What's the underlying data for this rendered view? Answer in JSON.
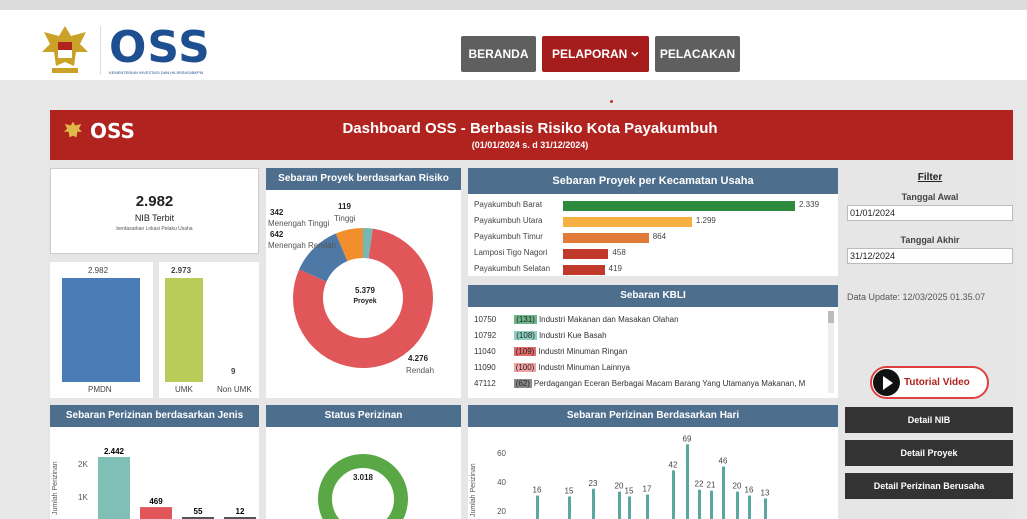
{
  "header": {
    "logo_text": "OSS",
    "logo_sub": "KEMENTERIAN INVESTASI DAN HILIRISASI/BKPM",
    "nav": [
      {
        "label": "BERANDA"
      },
      {
        "label": "PELAPORAN"
      },
      {
        "label": "PELACAKAN"
      }
    ]
  },
  "banner": {
    "logo_text": "OSS",
    "title": "Dashboard OSS - Berbasis Risiko Kota Payakumbuh",
    "subtitle": "(01/01/2024 s. d 31/12/2024)"
  },
  "nib": {
    "value": "2.982",
    "label": "NIB Terbit",
    "sublabel": "berdasarkan Lokasi Pelaku Usaha"
  },
  "pmdn": {
    "value": "2.982",
    "label": "PMDN",
    "color": "#4a7db6"
  },
  "umk": {
    "value": "2.973",
    "label": "UMK",
    "color": "#b9cc5a"
  },
  "non_umk": {
    "value": "9",
    "label": "Non UMK"
  },
  "risk": {
    "title": "Sebaran Proyek berdasarkan Risiko",
    "center_value": "5.379",
    "center_label": "Proyek",
    "slices": [
      {
        "name": "Rendah",
        "value": 4276,
        "label_value": "4.276",
        "color": "#e15759"
      },
      {
        "name": "Menengah Rendah",
        "value": 642,
        "label_value": "642",
        "color": "#4e79a7"
      },
      {
        "name": "Menengah Tinggi",
        "value": 342,
        "label_value": "342",
        "color": "#f28e2b"
      },
      {
        "name": "Tinggi",
        "value": 119,
        "label_value": "119",
        "color": "#76b7b2"
      }
    ]
  },
  "kecamatan": {
    "title": "Sebaran Proyek per Kecamatan Usaha",
    "rows": [
      {
        "name": "Payakumbuh Barat",
        "value": 2339,
        "label": "2.339",
        "color": "#2e8b3e"
      },
      {
        "name": "Payakumbuh Utara",
        "value": 1299,
        "label": "1.299",
        "color": "#f5b041"
      },
      {
        "name": "Payakumbuh Timur",
        "value": 864,
        "label": "864",
        "color": "#e07b39"
      },
      {
        "name": "Lamposi Tigo Nagori",
        "value": 458,
        "label": "458",
        "color": "#c0392b"
      },
      {
        "name": "Payakumbuh Selatan",
        "value": 419,
        "label": "419",
        "color": "#c0392b"
      }
    ]
  },
  "kbli": {
    "title": "Sebaran  KBLI",
    "rows": [
      {
        "code": "10750",
        "count": "(131)",
        "name": "Industri Makanan dan Masakan Olahan",
        "color": "#6fb58a"
      },
      {
        "code": "10792",
        "count": "(108)",
        "name": "Industri Kue Basah",
        "color": "#8ccfc0"
      },
      {
        "code": "11040",
        "count": "(109)",
        "name": "Industri Minuman Ringan",
        "color": "#e36b6b"
      },
      {
        "code": "11090",
        "count": "(100)",
        "name": "Industri Minuman Lainnya",
        "color": "#f4a3a3"
      },
      {
        "code": "47112",
        "count": "(62)",
        "name": "Perdagangan Eceran Berbagai Macam Barang Yang Utamanya Makanan, M",
        "color": "#8a8a8a"
      }
    ]
  },
  "jenis": {
    "title": "Sebaran Perizinan berdasarkan Jenis",
    "ylabel": "Jumlah Perizinan",
    "yticks": [
      "2K",
      "1K"
    ],
    "bars": [
      {
        "value": 2442,
        "label": "2.442",
        "color": "#7fbfb5"
      },
      {
        "value": 469,
        "label": "469",
        "color": "#e15759"
      },
      {
        "value": 55,
        "label": "55",
        "color": "#555"
      },
      {
        "value": 12,
        "label": "12",
        "color": "#555"
      }
    ]
  },
  "status": {
    "title": "Status Perizinan",
    "center_value": "3.018",
    "color": "#5aa845"
  },
  "hari": {
    "title": "Sebaran Perizinan Berdasarkan Hari",
    "ylabel": "Jumlah Perizinan",
    "yticks": [
      "60",
      "40",
      "20"
    ],
    "labels": [
      "16",
      "15",
      "23",
      "20",
      "15",
      "17",
      "42",
      "69",
      "22",
      "21",
      "46",
      "20",
      "16",
      "13"
    ]
  },
  "filter": {
    "title": "Filter",
    "start_label": "Tanggal Awal",
    "start_value": "01/01/2024",
    "end_label": "Tanggal Akhir",
    "end_value": "31/12/2024",
    "data_update": "Data Update: 12/03/2025 01.35.07"
  },
  "buttons": {
    "tutorial": "Tutorial Video",
    "detail_nib": "Detail NIB",
    "detail_proyek": "Detail Proyek",
    "detail_perizinan": "Detail Perizinan Berusaha"
  }
}
